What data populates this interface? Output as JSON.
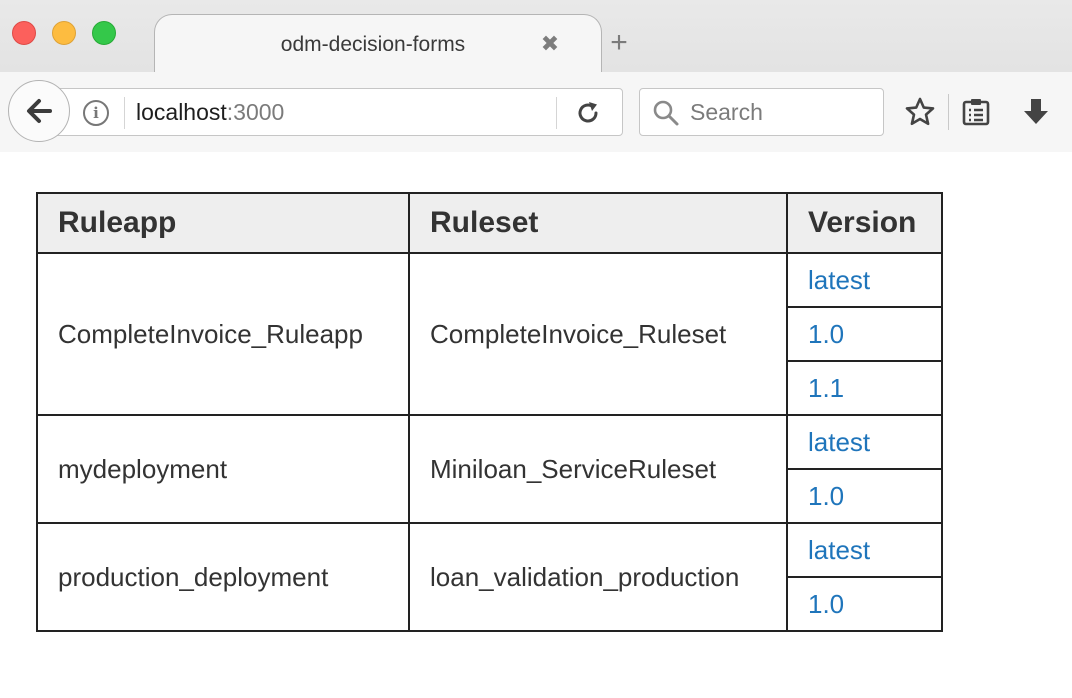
{
  "browser": {
    "tab_title": "odm-decision-forms",
    "tab_close_glyph": "✖",
    "new_tab_glyph": "+",
    "url_host": "localhost",
    "url_port": ":3000",
    "search_placeholder": "Search",
    "icons": [
      "back-arrow-icon",
      "info-icon",
      "reload-icon",
      "search-icon",
      "star-icon",
      "reader-list-icon",
      "download-icon"
    ],
    "traffic_colors": {
      "close": "#fc605c",
      "minimize": "#fdbc40",
      "zoom": "#34c84a"
    }
  },
  "table": {
    "headers": {
      "ruleapp": "Ruleapp",
      "ruleset": "Ruleset",
      "version": "Version"
    },
    "rows": [
      {
        "ruleapp": "CompleteInvoice_Ruleapp",
        "ruleset": "CompleteInvoice_Ruleset",
        "versions": [
          "latest",
          "1.0",
          "1.1"
        ]
      },
      {
        "ruleapp": "mydeployment",
        "ruleset": "Miniloan_ServiceRuleset",
        "versions": [
          "latest",
          "1.0"
        ]
      },
      {
        "ruleapp": "production_deployment",
        "ruleset": "loan_validation_production",
        "versions": [
          "latest",
          "1.0"
        ]
      }
    ],
    "link_color": "#1f75bb"
  }
}
